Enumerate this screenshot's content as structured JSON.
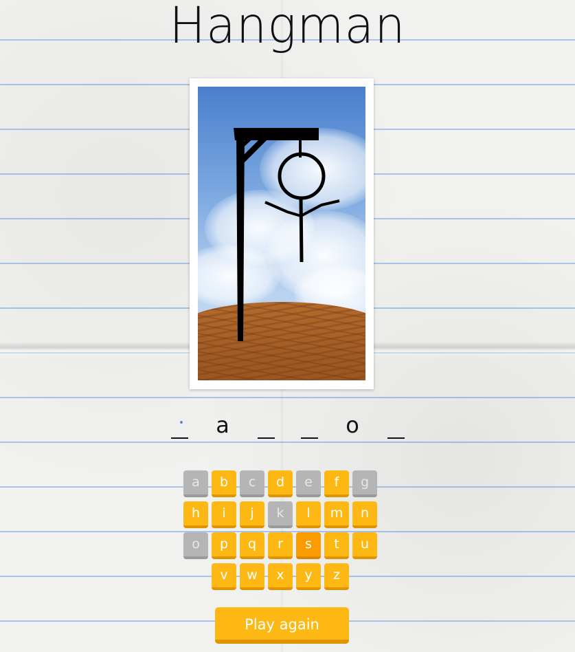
{
  "game": {
    "title": "Hangman",
    "word_slots": [
      "",
      "a",
      "",
      "",
      "o",
      ""
    ],
    "keyboard": {
      "rows": [
        [
          {
            "letter": "a",
            "state": "used"
          },
          {
            "letter": "b",
            "state": "available"
          },
          {
            "letter": "c",
            "state": "used"
          },
          {
            "letter": "d",
            "state": "available"
          },
          {
            "letter": "e",
            "state": "used"
          },
          {
            "letter": "f",
            "state": "available"
          },
          {
            "letter": "g",
            "state": "used"
          }
        ],
        [
          {
            "letter": "h",
            "state": "available"
          },
          {
            "letter": "i",
            "state": "available"
          },
          {
            "letter": "j",
            "state": "available"
          },
          {
            "letter": "k",
            "state": "used"
          },
          {
            "letter": "l",
            "state": "available"
          },
          {
            "letter": "m",
            "state": "available"
          },
          {
            "letter": "n",
            "state": "available"
          }
        ],
        [
          {
            "letter": "o",
            "state": "used"
          },
          {
            "letter": "p",
            "state": "available"
          },
          {
            "letter": "q",
            "state": "available"
          },
          {
            "letter": "r",
            "state": "available"
          },
          {
            "letter": "s",
            "state": "highlighted"
          },
          {
            "letter": "t",
            "state": "available"
          },
          {
            "letter": "u",
            "state": "available"
          }
        ],
        [
          {
            "letter": "v",
            "state": "available"
          },
          {
            "letter": "w",
            "state": "available"
          },
          {
            "letter": "x",
            "state": "available"
          },
          {
            "letter": "y",
            "state": "available"
          },
          {
            "letter": "z",
            "state": "available"
          }
        ]
      ]
    },
    "play_again_label": "Play again"
  },
  "colors": {
    "key_available": "#fdb813",
    "key_used": "#b5b5b5",
    "key_highlighted": "#fa9c00",
    "ruled_line": "#a9c4ea"
  },
  "hangman_stage": {
    "parts_drawn": [
      "gallows",
      "rope",
      "head",
      "body",
      "arms"
    ]
  }
}
